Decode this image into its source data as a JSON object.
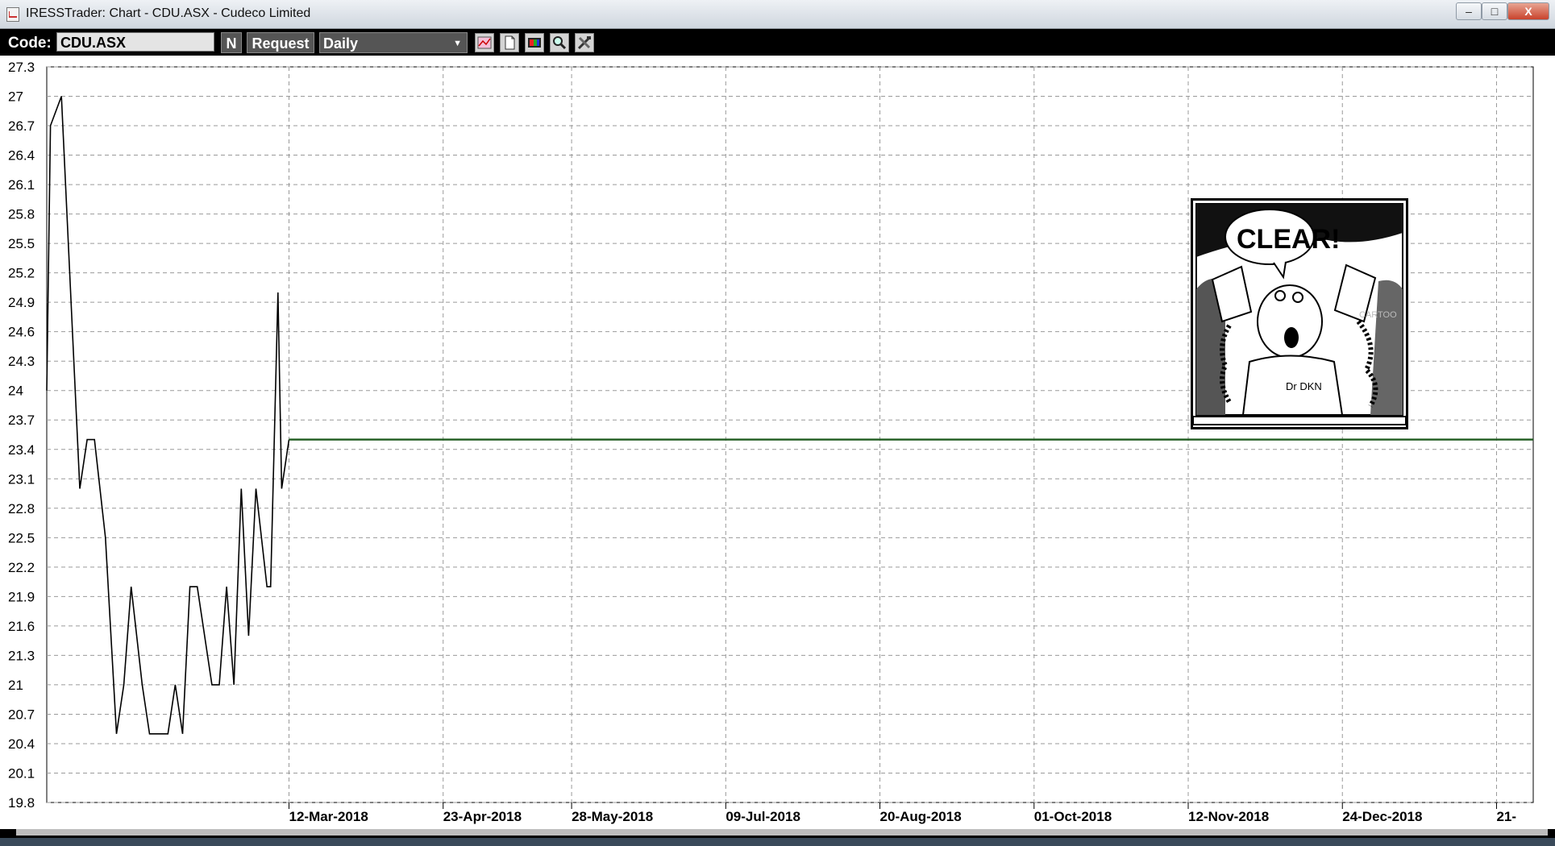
{
  "window": {
    "title": "IRESSTrader: Chart - CDU.ASX - Cudeco Limited",
    "min_glyph": "–",
    "max_glyph": "□",
    "close_glyph": "X"
  },
  "toolbar": {
    "code_label": "Code:",
    "code_value": "CDU.ASX",
    "n_label": "N",
    "request_label": "Request",
    "period_value": "Daily",
    "period_arrow": "▼",
    "icons": [
      "chart-type-icon",
      "page-icon",
      "color-palette-icon",
      "zoom-icon",
      "tools-icon"
    ]
  },
  "colors": {
    "price_line": "#000000",
    "forecast_line": "#1e5a1e",
    "grid": "#9a9a9a"
  },
  "chart_data": {
    "type": "line",
    "title": "",
    "xlabel": "",
    "ylabel": "",
    "ylim": [
      19.8,
      27.3
    ],
    "y_ticks": [
      "27.3",
      "27",
      "26.7",
      "26.4",
      "26.1",
      "25.8",
      "25.5",
      "25.2",
      "24.9",
      "24.6",
      "24.3",
      "24",
      "23.7",
      "23.4",
      "23.1",
      "22.8",
      "22.5",
      "22.2",
      "21.9",
      "21.6",
      "21.3",
      "21",
      "20.7",
      "20.4",
      "20.1",
      "19.8"
    ],
    "x_ticks": [
      {
        "date": "2018-03-12",
        "label": "12-Mar-2018"
      },
      {
        "date": "2018-04-23",
        "label": "23-Apr-2018"
      },
      {
        "date": "2018-05-28",
        "label": "28-May-2018"
      },
      {
        "date": "2018-07-09",
        "label": "09-Jul-2018"
      },
      {
        "date": "2018-08-20",
        "label": "20-Aug-2018"
      },
      {
        "date": "2018-10-01",
        "label": "01-Oct-2018"
      },
      {
        "date": "2018-11-12",
        "label": "12-Nov-2018"
      },
      {
        "date": "2018-12-24",
        "label": "24-Dec-2018"
      },
      {
        "date": "2019-02-04",
        "label": "21-"
      }
    ],
    "x_range": [
      "2018-01-05",
      "2019-02-14"
    ],
    "grid": true,
    "series": [
      {
        "x": [
          "2018-01-05",
          "2018-01-06",
          "2018-01-09",
          "2018-01-14",
          "2018-01-16",
          "2018-01-18",
          "2018-01-21",
          "2018-01-24",
          "2018-01-26",
          "2018-01-28",
          "2018-01-31",
          "2018-02-02",
          "2018-02-04",
          "2018-02-07",
          "2018-02-09",
          "2018-02-11",
          "2018-02-13",
          "2018-02-15",
          "2018-02-19",
          "2018-02-21",
          "2018-02-23",
          "2018-02-25",
          "2018-02-27",
          "2018-03-01",
          "2018-03-03",
          "2018-03-06",
          "2018-03-07",
          "2018-03-09",
          "2018-03-10",
          "2018-03-12"
        ],
        "values": [
          24.0,
          26.7,
          27.0,
          23.0,
          23.5,
          23.5,
          22.5,
          20.5,
          21.0,
          22.0,
          21.0,
          20.5,
          20.5,
          20.5,
          21.0,
          20.5,
          22.0,
          22.0,
          21.0,
          21.0,
          22.0,
          21.0,
          23.0,
          21.5,
          23.0,
          22.0,
          22.0,
          25.0,
          23.0,
          23.5
        ]
      },
      {
        "x": [
          "2018-03-12",
          "2019-02-14"
        ],
        "values": [
          23.5,
          23.5
        ]
      }
    ]
  },
  "cartoon": {
    "speech": "CLEAR!",
    "shirt_text": "Dr DKN",
    "watermark": "CARTOO"
  }
}
